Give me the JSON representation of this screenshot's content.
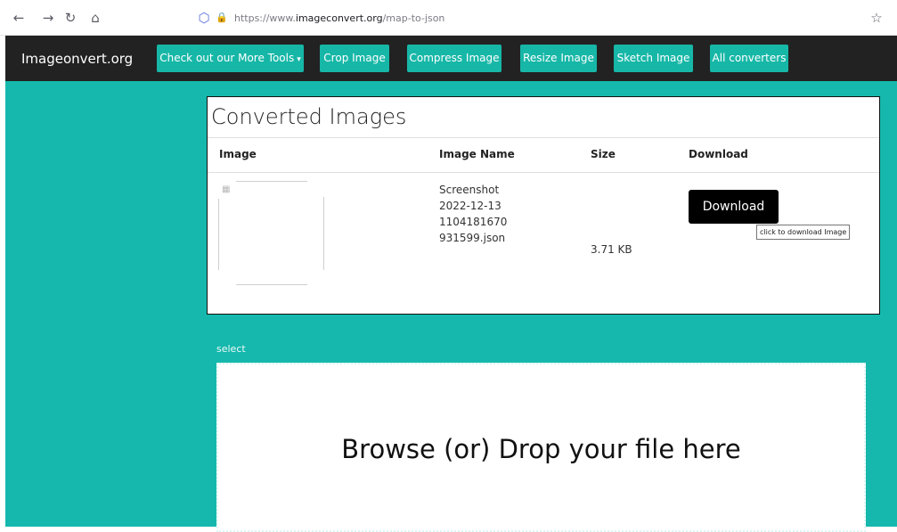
{
  "browser": {
    "icons": {
      "back": "←",
      "forward": "→",
      "reload": "↻",
      "home": "⌂",
      "shield": "⬡",
      "lock": "🔒",
      "star": "☆"
    },
    "url_prefix": "https://www.",
    "url_host": "imageconvert.org",
    "url_path": "/map-to-json"
  },
  "site": {
    "brand": "Imageonvert.org",
    "nav": {
      "more_tools": "Check out our More Tools",
      "caret": "▾",
      "crop": "Crop Image",
      "compress": "Compress Image",
      "resize": "Resize Image",
      "sketch": "Sketch Image",
      "all": "All converters"
    }
  },
  "results": {
    "title": "Converted Images",
    "headers": {
      "image": "Image",
      "name": "Image Name",
      "size": "Size",
      "download": "Download"
    },
    "row": {
      "thumbnail_icon": "broken-image-icon",
      "name_lines": [
        "Screenshot",
        "2022-12-13",
        "1104181670",
        "931599.json"
      ],
      "size": "3.71 KB",
      "download_label": "Download",
      "tooltip": "click to download Image"
    }
  },
  "upload": {
    "label": "select",
    "prompt": "Browse (or) Drop your file here"
  },
  "colors": {
    "teal": "#16b8ad",
    "button_teal": "#17b7a7",
    "navbar": "#222222",
    "download_bg": "#000000"
  }
}
